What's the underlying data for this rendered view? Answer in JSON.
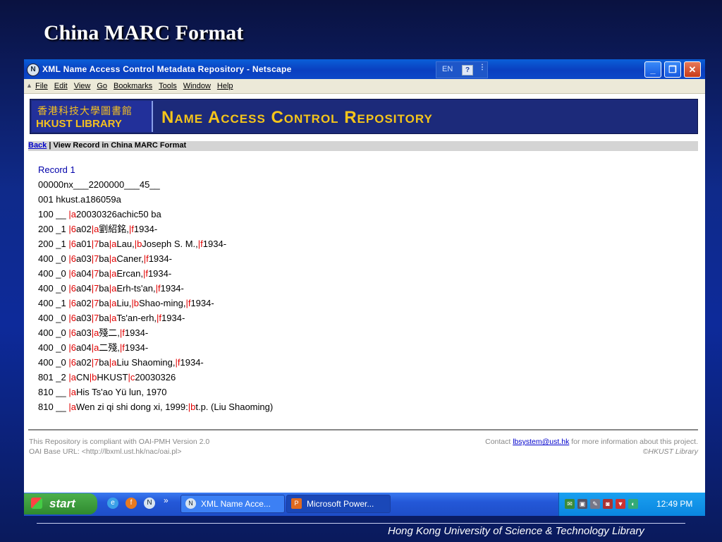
{
  "slide": {
    "title": "China MARC Format",
    "footer": "Hong Kong University of Science & Technology Library"
  },
  "window": {
    "title": "XML Name Access Control Metadata Repository - Netscape",
    "lang": "EN",
    "help_glyph": "?",
    "minimize": "_",
    "restore": "❐",
    "close": "✕"
  },
  "menu": [
    "File",
    "Edit",
    "View",
    "Go",
    "Bookmarks",
    "Tools",
    "Window",
    "Help"
  ],
  "banner": {
    "logo_zh": "香港科技大學圖書館",
    "logo_en": "HKUST LIBRARY",
    "repo_title": "Name Access Control Repository"
  },
  "breadcrumb": {
    "back": "Back",
    "rest": " | View Record in China MARC Format"
  },
  "record": {
    "title": "Record 1",
    "lines": [
      [
        {
          "t": "00000nx___2200000___45__"
        }
      ],
      [
        {
          "t": "001 hkust.a186059a"
        }
      ],
      [
        {
          "t": "100 __ "
        },
        {
          "s": "|a"
        },
        {
          "t": "20030326achic50 ba"
        }
      ],
      [
        {
          "t": "200 _1 "
        },
        {
          "s": "|6"
        },
        {
          "t": "a02"
        },
        {
          "s": "|a"
        },
        {
          "t": "劉紹銘,"
        },
        {
          "s": "|f"
        },
        {
          "t": "1934-"
        }
      ],
      [
        {
          "t": "200 _1 "
        },
        {
          "s": "|6"
        },
        {
          "t": "a01"
        },
        {
          "s": "|7"
        },
        {
          "t": "ba"
        },
        {
          "s": "|a"
        },
        {
          "t": "Lau,"
        },
        {
          "s": "|b"
        },
        {
          "t": "Joseph S. M.,"
        },
        {
          "s": "|f"
        },
        {
          "t": "1934-"
        }
      ],
      [
        {
          "t": "400 _0 "
        },
        {
          "s": "|6"
        },
        {
          "t": "a03"
        },
        {
          "s": "|7"
        },
        {
          "t": "ba"
        },
        {
          "s": "|a"
        },
        {
          "t": "Caner,"
        },
        {
          "s": "|f"
        },
        {
          "t": "1934-"
        }
      ],
      [
        {
          "t": "400 _0 "
        },
        {
          "s": "|6"
        },
        {
          "t": "a04"
        },
        {
          "s": "|7"
        },
        {
          "t": "ba"
        },
        {
          "s": "|a"
        },
        {
          "t": "Ercan,"
        },
        {
          "s": "|f"
        },
        {
          "t": "1934-"
        }
      ],
      [
        {
          "t": "400 _0 "
        },
        {
          "s": "|6"
        },
        {
          "t": "a04"
        },
        {
          "s": "|7"
        },
        {
          "t": "ba"
        },
        {
          "s": "|a"
        },
        {
          "t": "Erh-ts'an,"
        },
        {
          "s": "|f"
        },
        {
          "t": "1934-"
        }
      ],
      [
        {
          "t": "400 _1 "
        },
        {
          "s": "|6"
        },
        {
          "t": "a02"
        },
        {
          "s": "|7"
        },
        {
          "t": "ba"
        },
        {
          "s": "|a"
        },
        {
          "t": "Liu,"
        },
        {
          "s": "|b"
        },
        {
          "t": "Shao-ming,"
        },
        {
          "s": "|f"
        },
        {
          "t": "1934-"
        }
      ],
      [
        {
          "t": "400 _0 "
        },
        {
          "s": "|6"
        },
        {
          "t": "a03"
        },
        {
          "s": "|7"
        },
        {
          "t": "ba"
        },
        {
          "s": "|a"
        },
        {
          "t": "Ts'an-erh,"
        },
        {
          "s": "|f"
        },
        {
          "t": "1934-"
        }
      ],
      [
        {
          "t": "400 _0 "
        },
        {
          "s": "|6"
        },
        {
          "t": "a03"
        },
        {
          "s": "|a"
        },
        {
          "t": "殘二,"
        },
        {
          "s": "|f"
        },
        {
          "t": "1934-"
        }
      ],
      [
        {
          "t": "400 _0 "
        },
        {
          "s": "|6"
        },
        {
          "t": "a04"
        },
        {
          "s": "|a"
        },
        {
          "t": "二殘,"
        },
        {
          "s": "|f"
        },
        {
          "t": "1934-"
        }
      ],
      [
        {
          "t": "400 _0 "
        },
        {
          "s": "|6"
        },
        {
          "t": "a02"
        },
        {
          "s": "|7"
        },
        {
          "t": "ba"
        },
        {
          "s": "|a"
        },
        {
          "t": "Liu Shaoming,"
        },
        {
          "s": "|f"
        },
        {
          "t": "1934-"
        }
      ],
      [
        {
          "t": "801 _2 "
        },
        {
          "s": "|a"
        },
        {
          "t": "CN"
        },
        {
          "s": "|b"
        },
        {
          "t": "HKUST"
        },
        {
          "s": "|c"
        },
        {
          "t": "20030326"
        }
      ],
      [
        {
          "t": "810 __ "
        },
        {
          "s": "|a"
        },
        {
          "t": "His Ts'ao Yü lun, 1970"
        }
      ],
      [
        {
          "t": "810 __ "
        },
        {
          "s": "|a"
        },
        {
          "t": "Wen zi qi shi dong xi, 1999:"
        },
        {
          "s": "|b"
        },
        {
          "t": "t.p. (Liu Shaoming)"
        }
      ]
    ]
  },
  "footer": {
    "compliance": "This Repository is compliant with OAI-PMH Version 2.0",
    "base_url": "OAI Base URL: <http://lbxml.ust.hk/nac/oai.pl>",
    "contact_prefix": "Contact ",
    "contact_email": "lbsystem@ust.hk",
    "contact_suffix": " for more information about this project.",
    "copyright": "©HKUST Library"
  },
  "taskbar": {
    "start": "start",
    "more": "»",
    "tasks": [
      "XML Name Acce...",
      "Microsoft Power..."
    ],
    "clock": "12:49 PM"
  },
  "colors": {
    "subfield": "#e00000",
    "link": "#0000cc",
    "banner_gold": "#f5c51a"
  }
}
